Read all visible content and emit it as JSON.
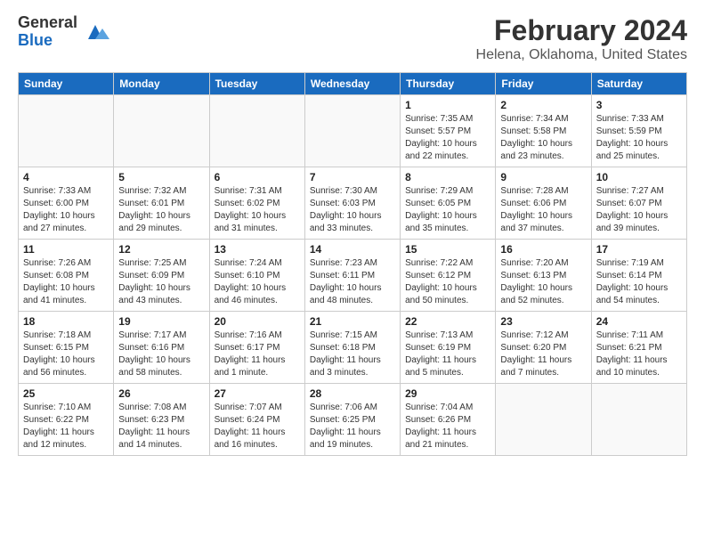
{
  "logo": {
    "general": "General",
    "blue": "Blue"
  },
  "title": "February 2024",
  "subtitle": "Helena, Oklahoma, United States",
  "days_of_week": [
    "Sunday",
    "Monday",
    "Tuesday",
    "Wednesday",
    "Thursday",
    "Friday",
    "Saturday"
  ],
  "weeks": [
    [
      {
        "day": "",
        "info": ""
      },
      {
        "day": "",
        "info": ""
      },
      {
        "day": "",
        "info": ""
      },
      {
        "day": "",
        "info": ""
      },
      {
        "day": "1",
        "info": "Sunrise: 7:35 AM\nSunset: 5:57 PM\nDaylight: 10 hours\nand 22 minutes."
      },
      {
        "day": "2",
        "info": "Sunrise: 7:34 AM\nSunset: 5:58 PM\nDaylight: 10 hours\nand 23 minutes."
      },
      {
        "day": "3",
        "info": "Sunrise: 7:33 AM\nSunset: 5:59 PM\nDaylight: 10 hours\nand 25 minutes."
      }
    ],
    [
      {
        "day": "4",
        "info": "Sunrise: 7:33 AM\nSunset: 6:00 PM\nDaylight: 10 hours\nand 27 minutes."
      },
      {
        "day": "5",
        "info": "Sunrise: 7:32 AM\nSunset: 6:01 PM\nDaylight: 10 hours\nand 29 minutes."
      },
      {
        "day": "6",
        "info": "Sunrise: 7:31 AM\nSunset: 6:02 PM\nDaylight: 10 hours\nand 31 minutes."
      },
      {
        "day": "7",
        "info": "Sunrise: 7:30 AM\nSunset: 6:03 PM\nDaylight: 10 hours\nand 33 minutes."
      },
      {
        "day": "8",
        "info": "Sunrise: 7:29 AM\nSunset: 6:05 PM\nDaylight: 10 hours\nand 35 minutes."
      },
      {
        "day": "9",
        "info": "Sunrise: 7:28 AM\nSunset: 6:06 PM\nDaylight: 10 hours\nand 37 minutes."
      },
      {
        "day": "10",
        "info": "Sunrise: 7:27 AM\nSunset: 6:07 PM\nDaylight: 10 hours\nand 39 minutes."
      }
    ],
    [
      {
        "day": "11",
        "info": "Sunrise: 7:26 AM\nSunset: 6:08 PM\nDaylight: 10 hours\nand 41 minutes."
      },
      {
        "day": "12",
        "info": "Sunrise: 7:25 AM\nSunset: 6:09 PM\nDaylight: 10 hours\nand 43 minutes."
      },
      {
        "day": "13",
        "info": "Sunrise: 7:24 AM\nSunset: 6:10 PM\nDaylight: 10 hours\nand 46 minutes."
      },
      {
        "day": "14",
        "info": "Sunrise: 7:23 AM\nSunset: 6:11 PM\nDaylight: 10 hours\nand 48 minutes."
      },
      {
        "day": "15",
        "info": "Sunrise: 7:22 AM\nSunset: 6:12 PM\nDaylight: 10 hours\nand 50 minutes."
      },
      {
        "day": "16",
        "info": "Sunrise: 7:20 AM\nSunset: 6:13 PM\nDaylight: 10 hours\nand 52 minutes."
      },
      {
        "day": "17",
        "info": "Sunrise: 7:19 AM\nSunset: 6:14 PM\nDaylight: 10 hours\nand 54 minutes."
      }
    ],
    [
      {
        "day": "18",
        "info": "Sunrise: 7:18 AM\nSunset: 6:15 PM\nDaylight: 10 hours\nand 56 minutes."
      },
      {
        "day": "19",
        "info": "Sunrise: 7:17 AM\nSunset: 6:16 PM\nDaylight: 10 hours\nand 58 minutes."
      },
      {
        "day": "20",
        "info": "Sunrise: 7:16 AM\nSunset: 6:17 PM\nDaylight: 11 hours\nand 1 minute."
      },
      {
        "day": "21",
        "info": "Sunrise: 7:15 AM\nSunset: 6:18 PM\nDaylight: 11 hours\nand 3 minutes."
      },
      {
        "day": "22",
        "info": "Sunrise: 7:13 AM\nSunset: 6:19 PM\nDaylight: 11 hours\nand 5 minutes."
      },
      {
        "day": "23",
        "info": "Sunrise: 7:12 AM\nSunset: 6:20 PM\nDaylight: 11 hours\nand 7 minutes."
      },
      {
        "day": "24",
        "info": "Sunrise: 7:11 AM\nSunset: 6:21 PM\nDaylight: 11 hours\nand 10 minutes."
      }
    ],
    [
      {
        "day": "25",
        "info": "Sunrise: 7:10 AM\nSunset: 6:22 PM\nDaylight: 11 hours\nand 12 minutes."
      },
      {
        "day": "26",
        "info": "Sunrise: 7:08 AM\nSunset: 6:23 PM\nDaylight: 11 hours\nand 14 minutes."
      },
      {
        "day": "27",
        "info": "Sunrise: 7:07 AM\nSunset: 6:24 PM\nDaylight: 11 hours\nand 16 minutes."
      },
      {
        "day": "28",
        "info": "Sunrise: 7:06 AM\nSunset: 6:25 PM\nDaylight: 11 hours\nand 19 minutes."
      },
      {
        "day": "29",
        "info": "Sunrise: 7:04 AM\nSunset: 6:26 PM\nDaylight: 11 hours\nand 21 minutes."
      },
      {
        "day": "",
        "info": ""
      },
      {
        "day": "",
        "info": ""
      }
    ]
  ]
}
